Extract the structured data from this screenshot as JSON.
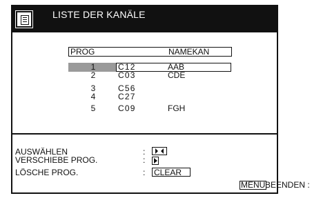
{
  "header": {
    "title": "LISTE DER KANÄLE",
    "icon": "document-list-icon"
  },
  "list": {
    "columns": {
      "prog": "PROG",
      "name": "NAMEKAN"
    },
    "rows": [
      {
        "prog": "1",
        "channel": "C12",
        "name": "AAB",
        "selected": true
      },
      {
        "prog": "2",
        "channel": "C03",
        "name": "CDE",
        "selected": false
      },
      {
        "prog": "3",
        "channel": "C56",
        "name": "",
        "selected": false
      },
      {
        "prog": "4",
        "channel": "C27",
        "name": "",
        "selected": false
      },
      {
        "prog": "5",
        "channel": "C09",
        "name": "FGH",
        "selected": false
      }
    ]
  },
  "options": {
    "select": {
      "label": "AUSWÄHLEN",
      "key_icon": "up-down-arrows-icon"
    },
    "move": {
      "label": "VERSCHIEBE PROG.",
      "key_icon": "right-arrow-icon"
    },
    "delete": {
      "label": "LÖSCHE PROG.",
      "key": "CLEAR"
    },
    "colon": ":"
  },
  "footer": {
    "menu_key": "MENU",
    "menu_action": "BEENDEN :"
  },
  "colors": {
    "header_bg": "#111111",
    "selection_bg": "#9a9a9a",
    "page_bg": "#ffffff"
  }
}
